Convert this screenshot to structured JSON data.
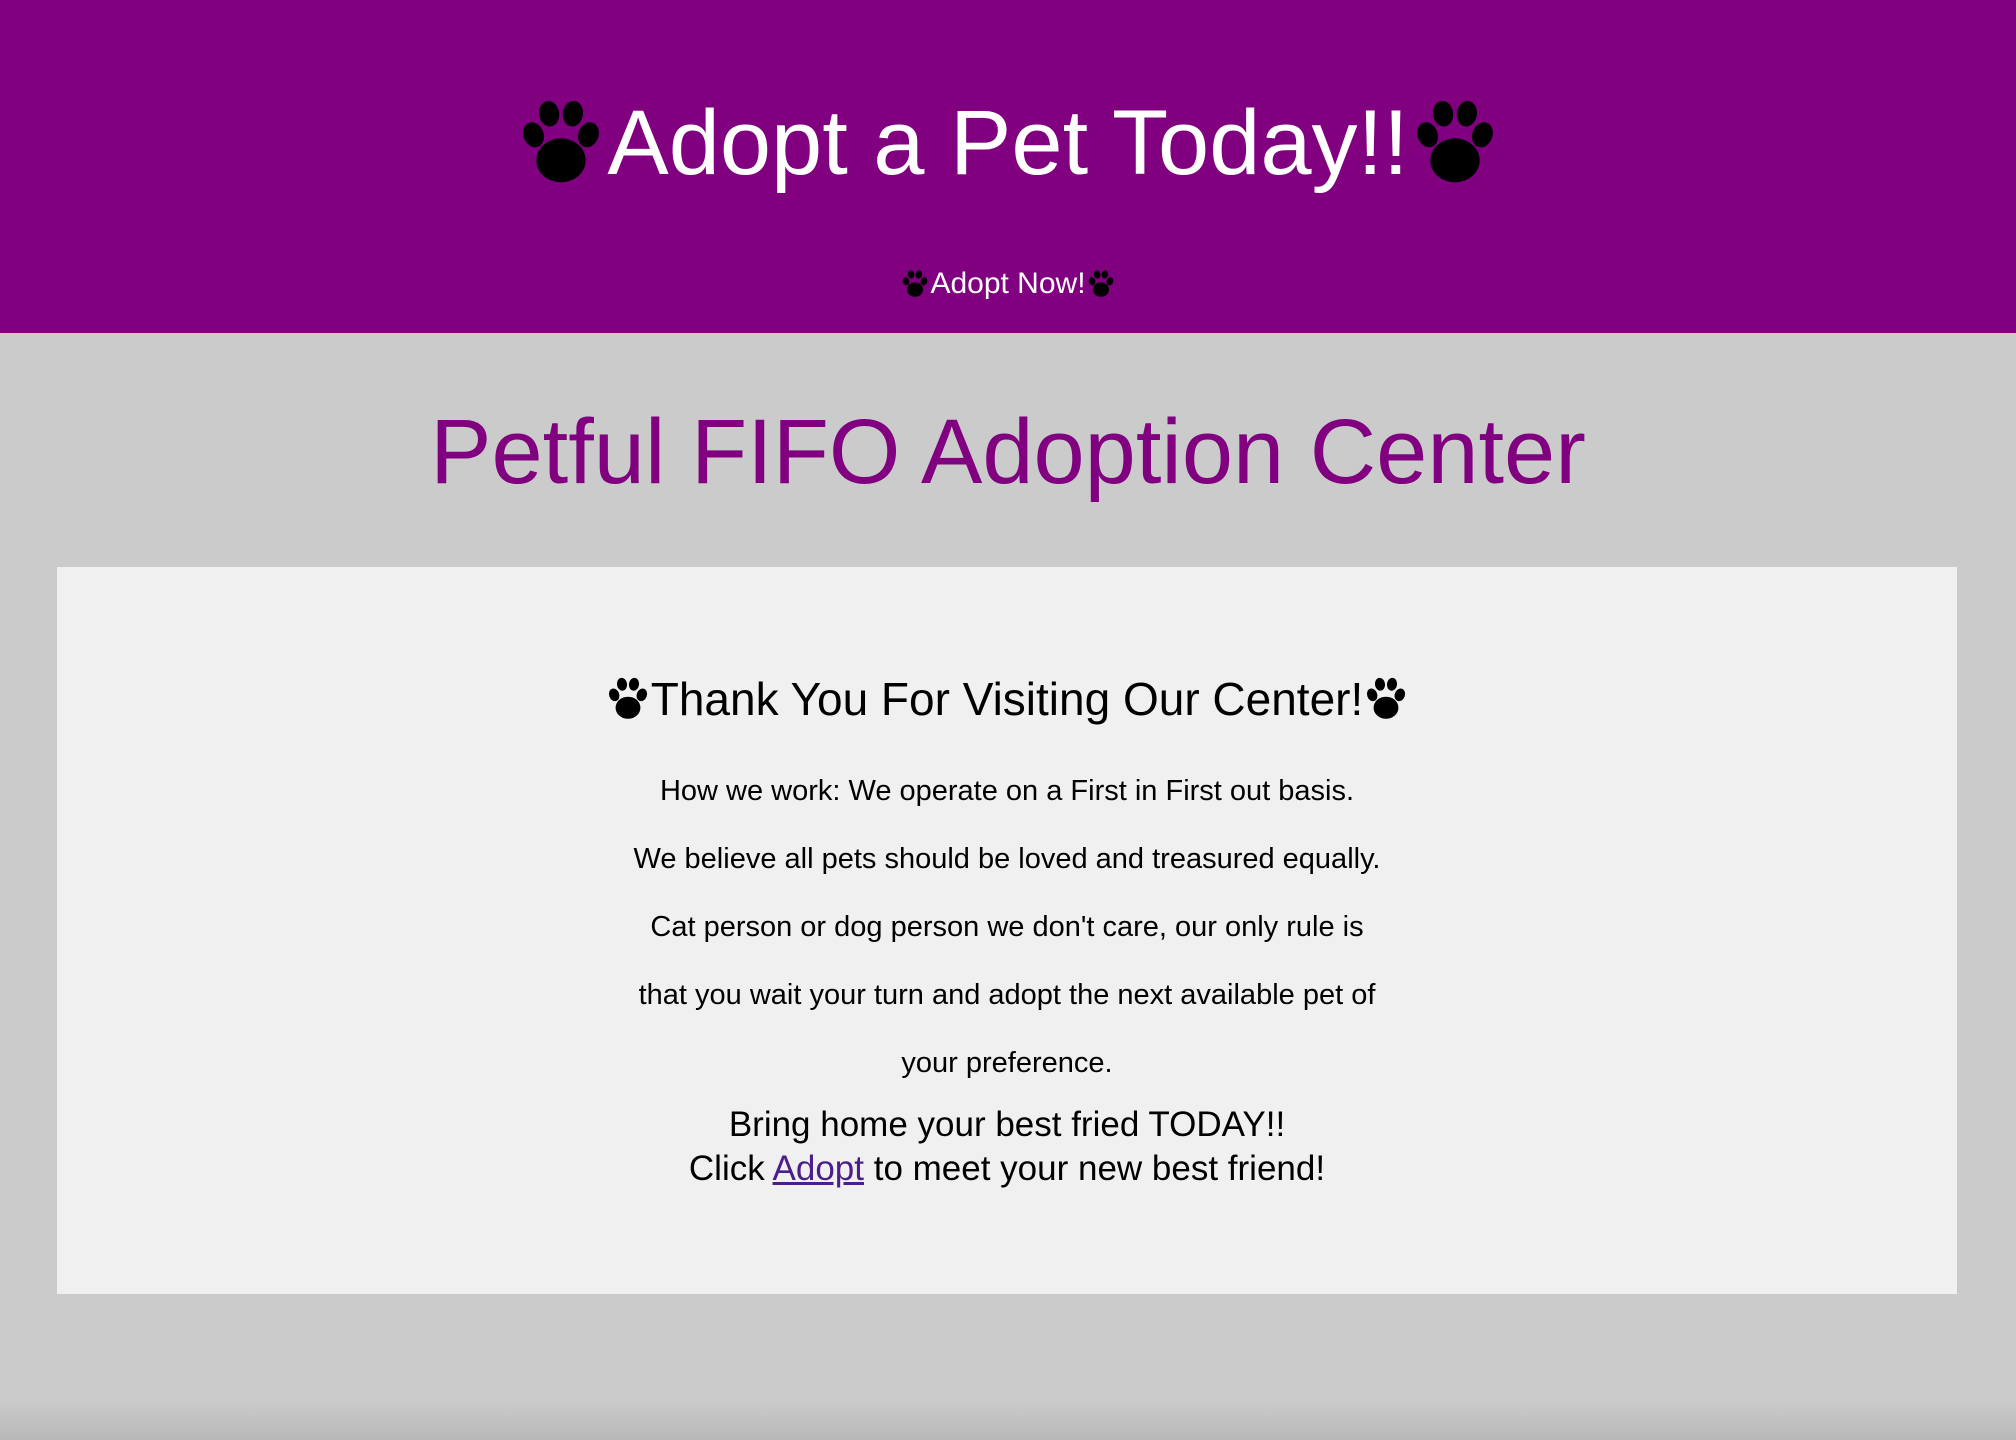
{
  "header": {
    "title": "Adopt a Pet Today!!",
    "nav_link": "Adopt Now!",
    "background_color": "#800080",
    "text_color": "#ffffff"
  },
  "main": {
    "site_title": "Petful FIFO Adoption Center",
    "title_color": "#800080"
  },
  "card": {
    "heading": "Thank You For Visiting Our Center!",
    "lines": [
      "How we work: We operate on a First in First out basis.",
      "We believe all pets should be loved and treasured equally.",
      "Cat person or dog person we don't care, our only rule is",
      "that you wait your turn and adopt the next available pet of",
      "your preference."
    ],
    "cta_line1": "Bring home your best fried TODAY!!",
    "cta_prefix": "Click",
    "cta_link": "Adopt",
    "cta_suffix": "to meet your new best friend!",
    "link_color": "#4b1e8c"
  },
  "icons": {
    "paw": "paw-print-icon"
  },
  "colors": {
    "page_background": "#cbcbcb",
    "card_background": "#f0f0f0"
  }
}
